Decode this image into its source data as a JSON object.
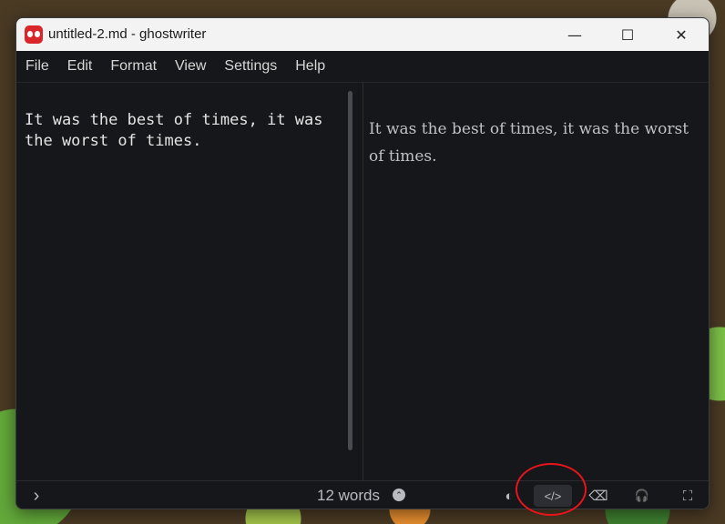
{
  "window": {
    "title": "untitled-2.md - ghostwriter",
    "controls": {
      "minimize": "—",
      "maximize": "☐",
      "close": "✕"
    }
  },
  "menubar": {
    "items": [
      {
        "label": "File"
      },
      {
        "label": "Edit"
      },
      {
        "label": "Format"
      },
      {
        "label": "View"
      },
      {
        "label": "Settings"
      },
      {
        "label": "Help"
      }
    ]
  },
  "editor": {
    "text": "It was the best of times, it was the worst of times."
  },
  "preview": {
    "text": "It was the best of times, it was the worst of times."
  },
  "statusbar": {
    "sidebar_toggle_glyph": "›",
    "word_count": "12 words",
    "word_count_menu_glyph": "⌃",
    "buttons": {
      "dark_mode_glyph": "◐",
      "html_preview_glyph": "</>",
      "hemingway_glyph": "⌫",
      "focus_mode_glyph": "🎧",
      "fullscreen_glyph": "⛶"
    }
  },
  "colors": {
    "window_bg": "#16171a",
    "text": "#e4e4e4",
    "preview_text": "#bfc1c5",
    "highlight_ring": "#e8141c"
  }
}
